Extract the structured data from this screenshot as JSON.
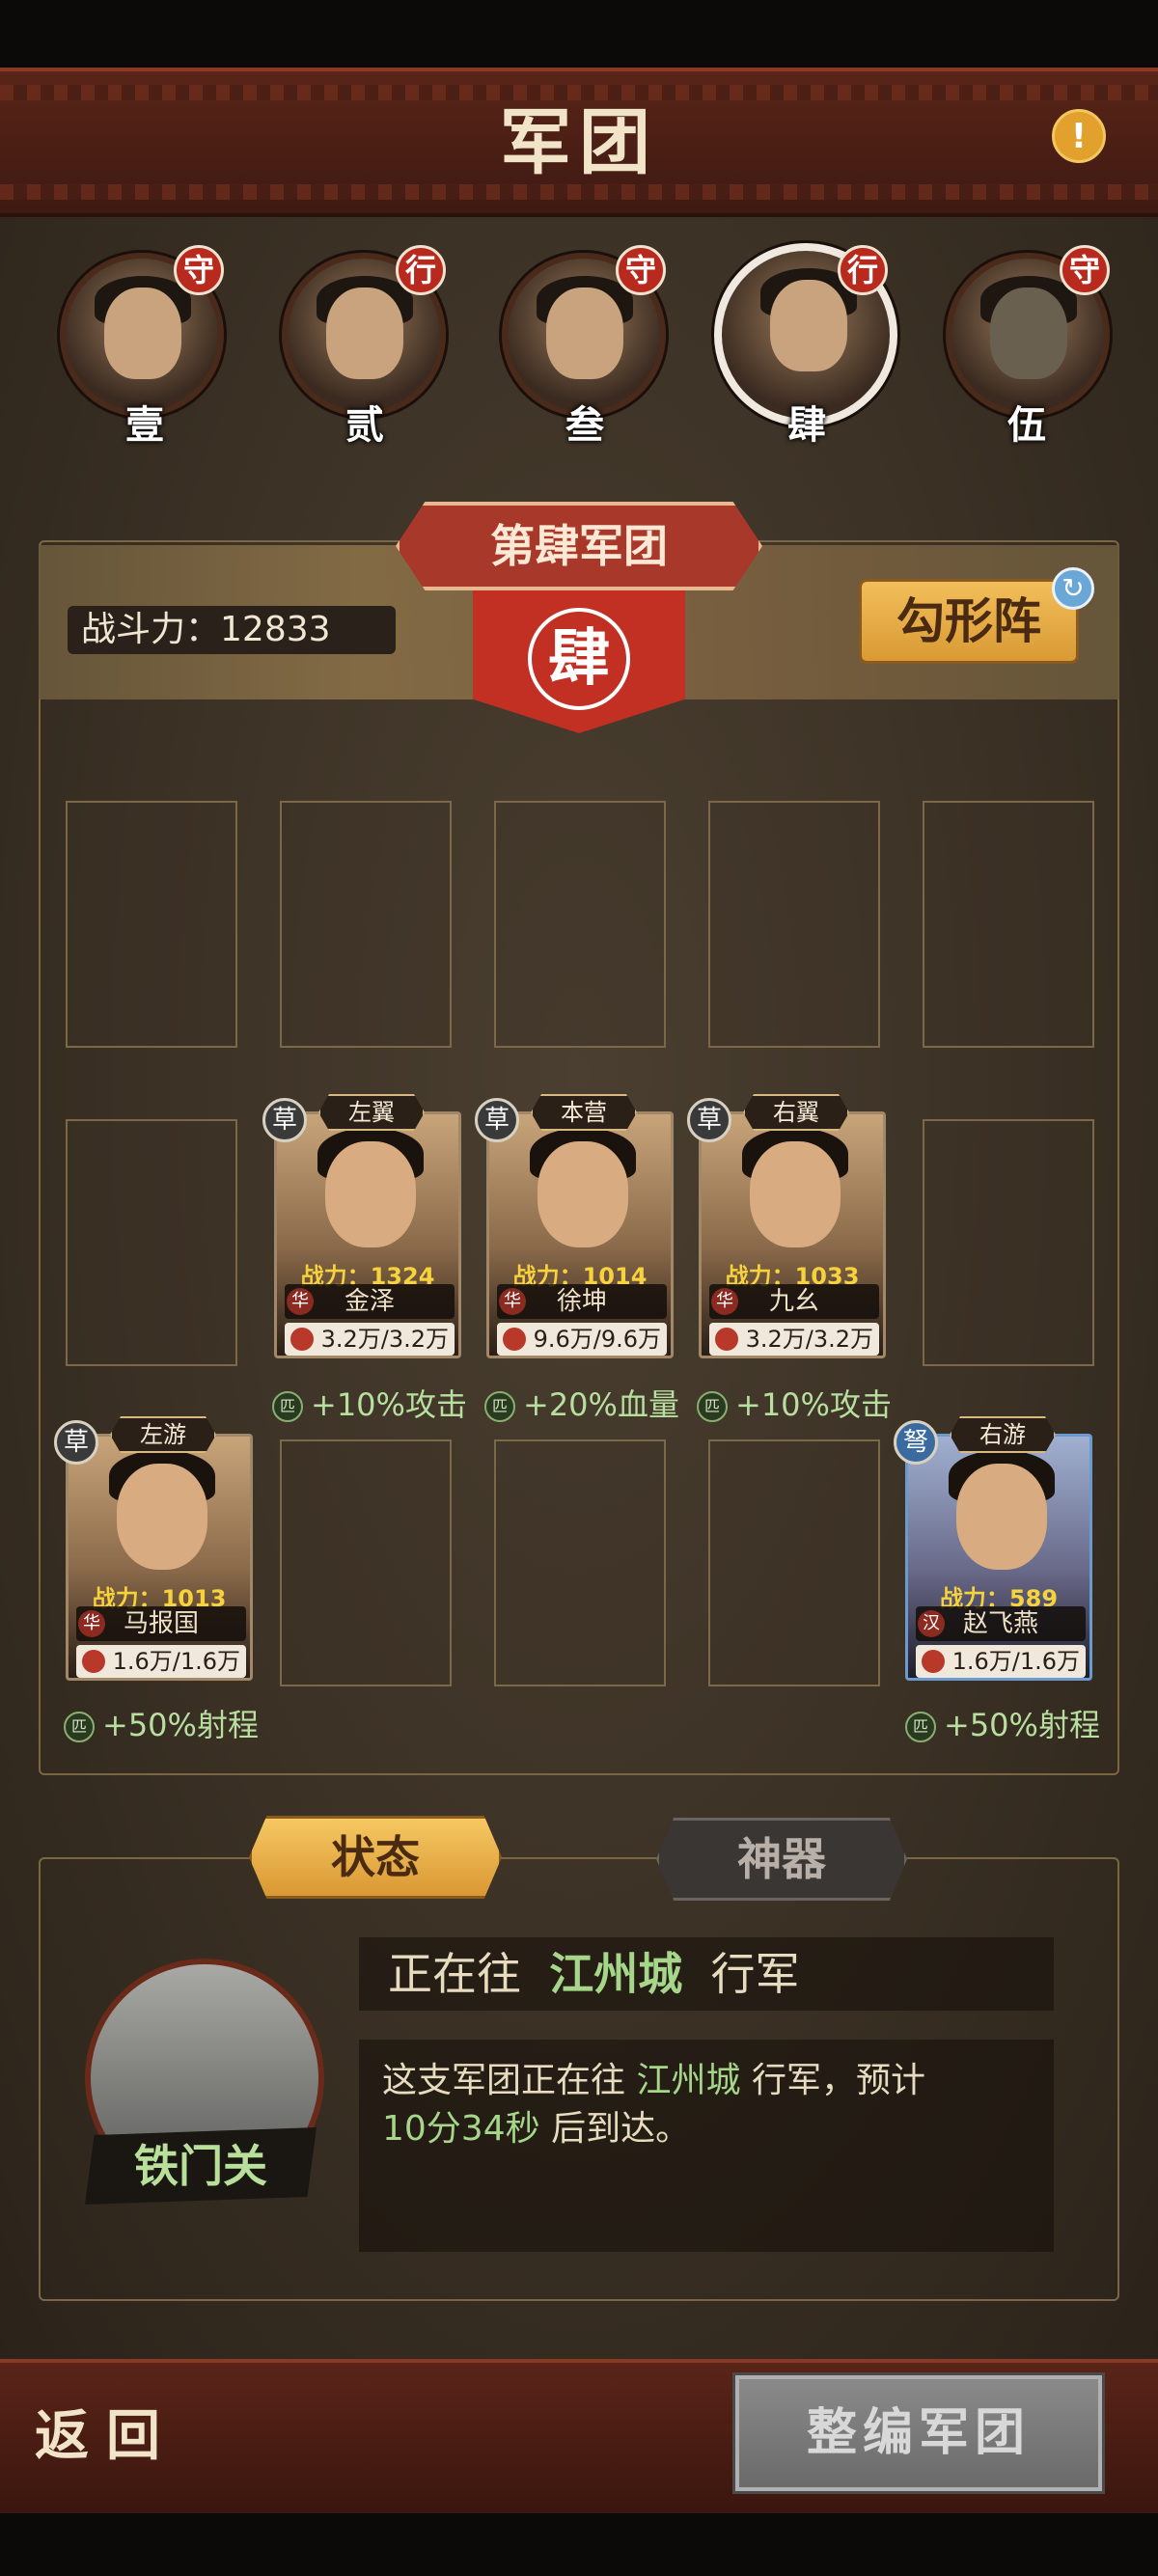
{
  "title": "军团",
  "heroes": [
    {
      "badge": "守",
      "num": "壹"
    },
    {
      "badge": "行",
      "num": "贰"
    },
    {
      "badge": "守",
      "num": "叁"
    },
    {
      "badge": "行",
      "num": "肆"
    },
    {
      "badge": "守",
      "num": "伍"
    }
  ],
  "legion": {
    "banner": "第肆军团",
    "seal": "肆",
    "power_label": "战斗力：",
    "power_value": "12833",
    "formation": "勾形阵"
  },
  "cards": [
    {
      "troop": "草",
      "position": "左翼",
      "power": "战力：1324",
      "faction": "华",
      "name": "金泽",
      "hp": "3.2万/3.2万",
      "bonus_icon": "匹",
      "bonus": "+10%攻击"
    },
    {
      "troop": "草",
      "position": "本营",
      "power": "战力：1014",
      "faction": "华",
      "name": "徐坤",
      "hp": "9.6万/9.6万",
      "bonus_icon": "匹",
      "bonus": "+20%血量"
    },
    {
      "troop": "草",
      "position": "右翼",
      "power": "战力：1033",
      "faction": "华",
      "name": "九幺",
      "hp": "3.2万/3.2万",
      "bonus_icon": "匹",
      "bonus": "+10%攻击"
    },
    {
      "troop": "草",
      "position": "左游",
      "power": "战力：1013",
      "faction": "华",
      "name": "马报国",
      "hp": "1.6万/1.6万",
      "bonus_icon": "匹",
      "bonus": "+50%射程"
    },
    {
      "troop": "弩",
      "position": "右游",
      "power": "战力：589",
      "faction": "汉",
      "name": "赵飞燕",
      "hp": "1.6万/1.6万",
      "bonus_icon": "匹",
      "bonus": "+50%射程"
    }
  ],
  "tabs": {
    "status": "状态",
    "artifact": "神器"
  },
  "status": {
    "city_name": "铁门关",
    "march_prefix": "正在往",
    "march_city": "江州城",
    "march_suffix": "行军",
    "desc_prefix": "这支军团正在往",
    "desc_city": "江州城",
    "desc_middle": "行军，预计",
    "desc_time": "10分34秒",
    "desc_suffix": "后到达。"
  },
  "footer": {
    "back": "返回",
    "reorganize": "整编军团"
  },
  "icons": {
    "alert": "exclamation-icon",
    "refresh": "refresh-icon"
  },
  "colors": {
    "accent_red": "#b82a1e",
    "gold": "#d99a34",
    "green_text": "#a6d68a"
  }
}
